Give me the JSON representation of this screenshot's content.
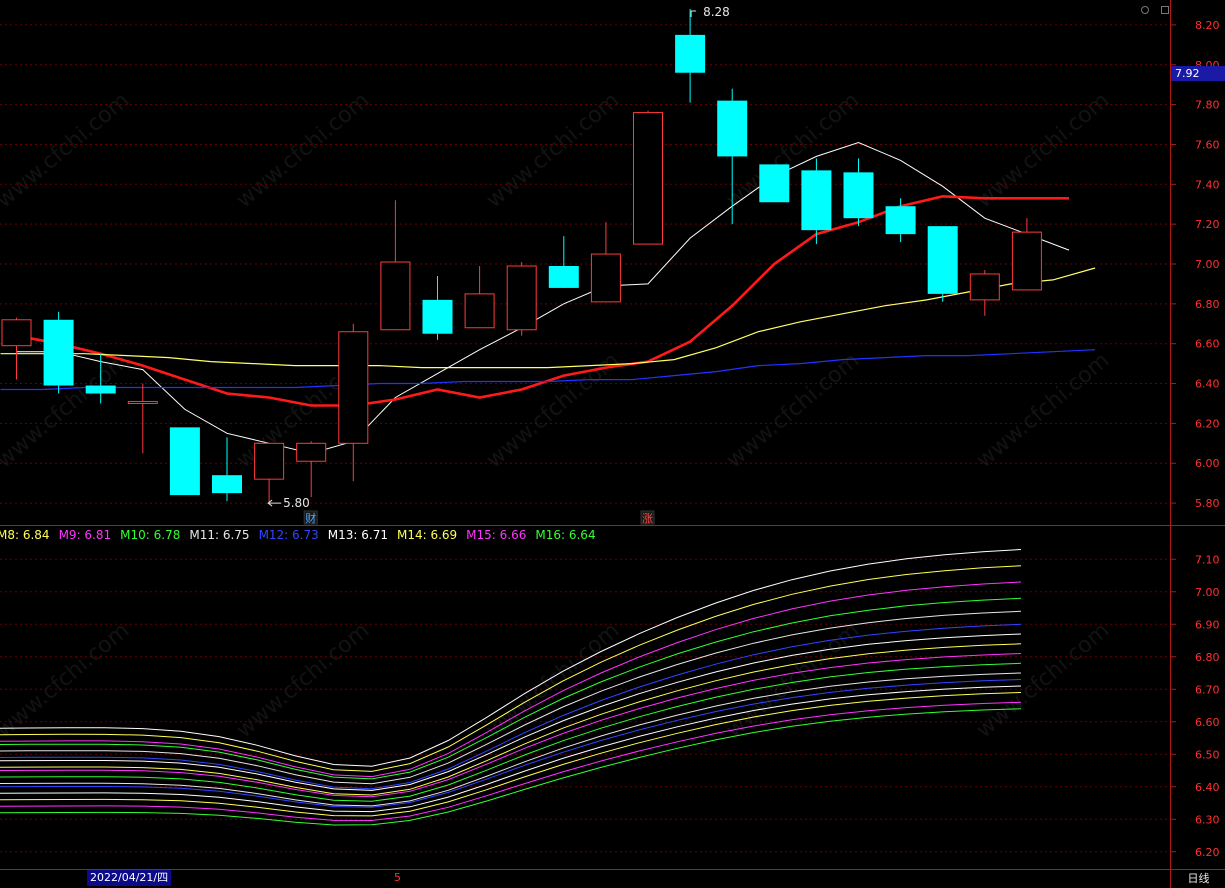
{
  "colors": {
    "background": "#000000",
    "axis": "#b01818",
    "grid": "#6a0000",
    "tick_text": "#ff3030",
    "up_candle": "#ff3a3a",
    "down_candle": "#00ffff",
    "ma_short": "#ffffff",
    "ma_mid": "#ff1a1a",
    "ma_long": "#ffff66",
    "ma_longest": "#2233ff"
  },
  "top_right_icons": [
    "window-minimize-icon",
    "window-close-icon"
  ],
  "current_price_label": "7.92",
  "period_label": "日线",
  "date_label": "2022/04/21/四",
  "month_marker": "5",
  "badges": [
    {
      "text": "财",
      "at_candle": 7,
      "color": "#4aa8ff"
    },
    {
      "text": "涨",
      "at_candle": 15,
      "color": "#ff4a4a"
    }
  ],
  "annotations": {
    "high": {
      "text": "8.28",
      "value": 8.28,
      "at_candle": 16
    },
    "low": {
      "text": "5.80",
      "value": 5.8,
      "at_candle": 6
    }
  },
  "watermark": "www.cfchi.com",
  "indicator_legend": [
    {
      "text": "M8: 6.84",
      "color": "#ffff55"
    },
    {
      "text": "M9: 6.81",
      "color": "#ff33ff"
    },
    {
      "text": "M10: 6.78",
      "color": "#33ff33"
    },
    {
      "text": "M11: 6.75",
      "color": "#e6e6e6"
    },
    {
      "text": "M12: 6.73",
      "color": "#3344ff"
    },
    {
      "text": "M13: 6.71",
      "color": "#ffffff"
    },
    {
      "text": "M14: 6.69",
      "color": "#ffff55"
    },
    {
      "text": "M15: 6.66",
      "color": "#ff33ff"
    },
    {
      "text": "M16: 6.64",
      "color": "#33ff33"
    }
  ],
  "chart_data": [
    {
      "type": "candlestick",
      "title": "",
      "ylim": [
        5.7,
        8.3
      ],
      "y_ticks": [
        5.8,
        6.0,
        6.2,
        6.4,
        6.6,
        6.8,
        7.0,
        7.2,
        7.4,
        7.6,
        7.8,
        8.0,
        8.2
      ],
      "y_tick_labels": [
        "5.80",
        "6.00",
        "6.20",
        "6.40",
        "6.60",
        "6.80",
        "7.00",
        "7.20",
        "7.40",
        "7.60",
        "7.80",
        "8.00",
        "8.20"
      ],
      "grid": true,
      "candles": [
        {
          "open": 6.59,
          "high": 6.73,
          "low": 6.42,
          "close": 6.72
        },
        {
          "open": 6.72,
          "high": 6.76,
          "low": 6.35,
          "close": 6.39
        },
        {
          "open": 6.39,
          "high": 6.55,
          "low": 6.3,
          "close": 6.35
        },
        {
          "open": 6.3,
          "high": 6.4,
          "low": 6.05,
          "close": 6.31
        },
        {
          "open": 6.18,
          "high": 6.18,
          "low": 5.84,
          "close": 5.84
        },
        {
          "open": 5.94,
          "high": 6.13,
          "low": 5.81,
          "close": 5.85
        },
        {
          "open": 5.92,
          "high": 6.1,
          "low": 5.8,
          "close": 6.1
        },
        {
          "open": 6.01,
          "high": 6.11,
          "low": 5.83,
          "close": 6.1
        },
        {
          "open": 6.1,
          "high": 6.7,
          "low": 5.91,
          "close": 6.66
        },
        {
          "open": 6.67,
          "high": 7.32,
          "low": 6.67,
          "close": 7.01
        },
        {
          "open": 6.82,
          "high": 6.94,
          "low": 6.62,
          "close": 6.65
        },
        {
          "open": 6.68,
          "high": 6.99,
          "low": 6.68,
          "close": 6.85
        },
        {
          "open": 6.67,
          "high": 7.01,
          "low": 6.64,
          "close": 6.99
        },
        {
          "open": 6.99,
          "high": 7.14,
          "low": 6.89,
          "close": 6.88
        },
        {
          "open": 6.81,
          "high": 7.21,
          "low": 6.81,
          "close": 7.05
        },
        {
          "open": 7.1,
          "high": 7.77,
          "low": 7.1,
          "close": 7.76
        },
        {
          "open": 8.15,
          "high": 8.28,
          "low": 7.81,
          "close": 7.96
        },
        {
          "open": 7.82,
          "high": 7.88,
          "low": 7.2,
          "close": 7.54
        },
        {
          "open": 7.5,
          "high": 7.5,
          "low": 7.31,
          "close": 7.31
        },
        {
          "open": 7.47,
          "high": 7.53,
          "low": 7.1,
          "close": 7.17
        },
        {
          "open": 7.46,
          "high": 7.53,
          "low": 7.19,
          "close": 7.23
        },
        {
          "open": 7.29,
          "high": 7.33,
          "low": 7.11,
          "close": 7.15
        },
        {
          "open": 7.19,
          "high": 7.19,
          "low": 6.81,
          "close": 6.85
        },
        {
          "open": 6.82,
          "high": 6.97,
          "low": 6.74,
          "close": 6.95
        },
        {
          "open": 6.87,
          "high": 7.23,
          "low": 6.87,
          "close": 7.16
        }
      ],
      "series": [
        {
          "color": "#ffffff",
          "values": [
            6.56,
            6.56,
            6.51,
            6.47,
            6.27,
            6.15,
            6.1,
            6.05,
            6.11,
            6.33,
            6.45,
            6.57,
            6.68,
            6.8,
            6.89,
            6.9,
            7.13,
            7.29,
            7.44,
            7.54,
            7.61,
            7.52,
            7.39,
            7.23,
            7.15,
            7.07
          ]
        },
        {
          "color": "#ff1a1a",
          "values": [
            6.64,
            6.6,
            6.55,
            6.49,
            6.42,
            6.35,
            6.33,
            6.29,
            6.29,
            6.32,
            6.37,
            6.33,
            6.37,
            6.44,
            6.48,
            6.51,
            6.61,
            6.79,
            7.0,
            7.15,
            7.21,
            7.29,
            7.34,
            7.33,
            7.33,
            7.33
          ]
        },
        {
          "color": "#ffff66",
          "values": [
            6.55,
            6.55,
            6.55,
            6.54,
            6.53,
            6.51,
            6.5,
            6.49,
            6.49,
            6.49,
            6.48,
            6.48,
            6.48,
            6.48,
            6.49,
            6.5,
            6.52,
            6.58,
            6.66,
            6.71,
            6.75,
            6.79,
            6.82,
            6.86,
            6.9,
            6.92,
            6.98
          ]
        },
        {
          "color": "#2233ff",
          "values": [
            6.37,
            6.37,
            6.38,
            6.38,
            6.38,
            6.38,
            6.38,
            6.38,
            6.39,
            6.4,
            6.4,
            6.41,
            6.41,
            6.41,
            6.42,
            6.42,
            6.44,
            6.46,
            6.49,
            6.5,
            6.52,
            6.53,
            6.54,
            6.54,
            6.55,
            6.56,
            6.57
          ]
        }
      ]
    },
    {
      "type": "line",
      "title": "",
      "ylim": [
        6.15,
        7.15
      ],
      "y_ticks": [
        6.2,
        6.3,
        6.4,
        6.5,
        6.6,
        6.7,
        6.8,
        6.9,
        7.0,
        7.1
      ],
      "y_tick_labels": [
        "6.20",
        "6.30",
        "6.40",
        "6.50",
        "6.60",
        "6.70",
        "6.80",
        "6.90",
        "7.00",
        "7.10"
      ],
      "grid": true,
      "band_endpoints": {
        "start": [
          6.58,
          6.56,
          6.54,
          6.53,
          6.51,
          6.49,
          6.48,
          6.46,
          6.45,
          6.43,
          6.41,
          6.4,
          6.38,
          6.36,
          6.34,
          6.32
        ],
        "end": [
          7.13,
          7.08,
          7.03,
          6.98,
          6.94,
          6.9,
          6.87,
          6.84,
          6.81,
          6.78,
          6.75,
          6.73,
          6.71,
          6.69,
          6.66,
          6.64
        ],
        "shape": [
          0.0,
          0.05,
          0.18,
          0.45,
          0.84,
          1.0,
          0.87,
          0.55,
          0.18,
          -0.6,
          -1.4,
          -2.2,
          -3.4,
          -4.6,
          -5.9,
          -7.0,
          -8.4,
          -9.6,
          -10.6,
          -11.0,
          -11.3,
          -11.5,
          -11.7,
          -11.9,
          -12.0,
          -12.1,
          -12.2,
          -12.2
        ]
      },
      "series": [
        {
          "color": "#ffffff"
        },
        {
          "color": "#ffff55"
        },
        {
          "color": "#ff33ff"
        },
        {
          "color": "#33ff33"
        },
        {
          "color": "#e6e6e6"
        },
        {
          "color": "#3344ff"
        },
        {
          "color": "#ffffff"
        },
        {
          "color": "#ffff55"
        },
        {
          "color": "#ff33ff"
        },
        {
          "color": "#33ff33"
        },
        {
          "color": "#e6e6e6"
        },
        {
          "color": "#3344ff"
        },
        {
          "color": "#ffffff"
        },
        {
          "color": "#ffff55"
        },
        {
          "color": "#ff33ff"
        },
        {
          "color": "#33ff33"
        }
      ]
    }
  ]
}
